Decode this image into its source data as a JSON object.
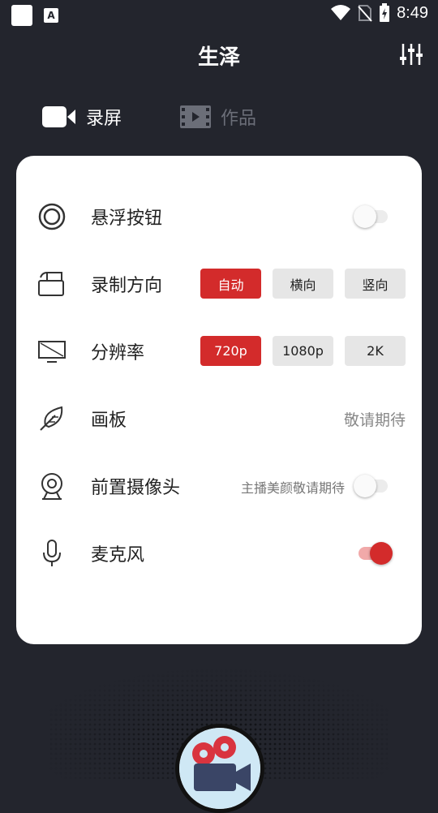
{
  "status_bar": {
    "time": "8:49",
    "indicator": "A"
  },
  "header": {
    "title": "生泽"
  },
  "tabs": [
    {
      "label": "录屏",
      "active": true
    },
    {
      "label": "作品",
      "active": false
    }
  ],
  "settings": {
    "floating_button": {
      "label": "悬浮按钮",
      "enabled": false
    },
    "record_orientation": {
      "label": "录制方向",
      "options": [
        "自动",
        "横向",
        "竖向"
      ],
      "selected": "自动"
    },
    "resolution": {
      "label": "分辨率",
      "options": [
        "720p",
        "1080p",
        "2K"
      ],
      "selected": "720p"
    },
    "brush": {
      "label": "画板",
      "status": "敬请期待"
    },
    "front_camera": {
      "label": "前置摄像头",
      "hint": "主播美颜敬请期待",
      "enabled": false
    },
    "microphone": {
      "label": "麦克风",
      "enabled": true
    }
  },
  "colors": {
    "accent": "#d32b2b",
    "background": "#23252d",
    "card": "#ffffff"
  }
}
